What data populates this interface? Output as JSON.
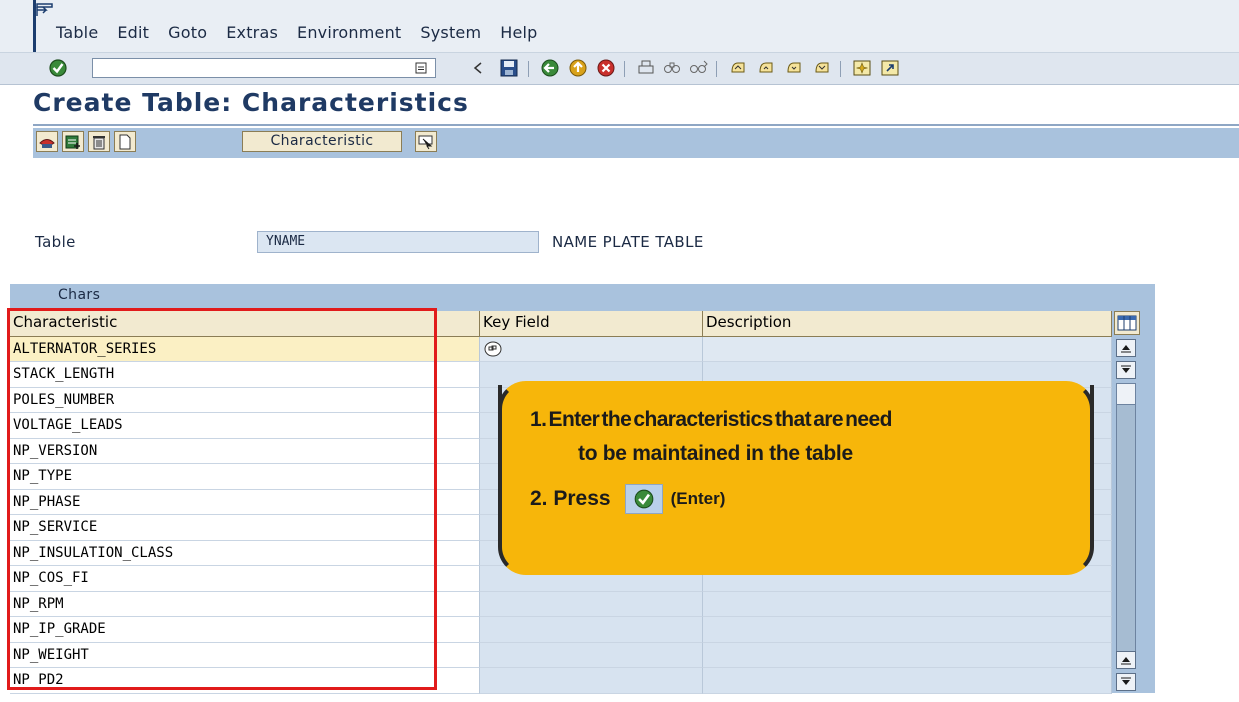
{
  "menubar": {
    "items": [
      {
        "label": "Table"
      },
      {
        "label": "Edit"
      },
      {
        "label": "Goto"
      },
      {
        "label": "Extras"
      },
      {
        "label": "Environment"
      },
      {
        "label": "System"
      },
      {
        "label": "Help"
      }
    ]
  },
  "toolbar": {
    "command_field_value": "",
    "icons": [
      "enter-check-icon",
      "save-icon",
      "back-icon",
      "exit-icon",
      "cancel-icon",
      "print-icon",
      "find-icon",
      "find-next-icon",
      "first-page-icon",
      "previous-page-icon",
      "next-page-icon",
      "last-page-icon",
      "create-session-icon",
      "shortcut-icon"
    ]
  },
  "page": {
    "title": "Create Table: Characteristics"
  },
  "app_toolbar": {
    "characteristic_button_label": "Characteristic",
    "icons": [
      "display-icon",
      "insert-row-icon",
      "delete-icon",
      "new-icon",
      "select-icon"
    ]
  },
  "header": {
    "table_label": "Table",
    "table_value": "YNAME",
    "table_description": "NAME PLATE TABLE"
  },
  "chars_table": {
    "title": "Chars",
    "columns": [
      "Characteristic",
      "Key Field",
      "Description"
    ],
    "rows": [
      {
        "characteristic": "ALTERNATOR_SERIES",
        "key_field": true,
        "description": ""
      },
      {
        "characteristic": "STACK_LENGTH",
        "key_field": false,
        "description": ""
      },
      {
        "characteristic": "POLES_NUMBER",
        "key_field": false,
        "description": ""
      },
      {
        "characteristic": "VOLTAGE_LEADS",
        "key_field": false,
        "description": ""
      },
      {
        "characteristic": "NP_VERSION",
        "key_field": false,
        "description": ""
      },
      {
        "characteristic": "NP_TYPE",
        "key_field": false,
        "description": ""
      },
      {
        "characteristic": "NP_PHASE",
        "key_field": false,
        "description": ""
      },
      {
        "characteristic": "NP_SERVICE",
        "key_field": false,
        "description": ""
      },
      {
        "characteristic": "NP_INSULATION_CLASS",
        "key_field": false,
        "description": ""
      },
      {
        "characteristic": "NP_COS_FI",
        "key_field": false,
        "description": ""
      },
      {
        "characteristic": "NP_RPM",
        "key_field": false,
        "description": ""
      },
      {
        "characteristic": "NP_IP_GRADE",
        "key_field": false,
        "description": ""
      },
      {
        "characteristic": "NP_WEIGHT",
        "key_field": false,
        "description": ""
      },
      {
        "characteristic": "NP_PD2",
        "key_field": false,
        "description": ""
      }
    ]
  },
  "callout": {
    "line1": "1. Enter the characteristics that are need",
    "line2": "to be maintained in the table",
    "line3_prefix": "2. Press",
    "line3_suffix": "(Enter)"
  },
  "colors": {
    "highlight_box": "#e11b1b",
    "callout_fill": "#f7b60a",
    "title_color": "#1f3a64"
  }
}
